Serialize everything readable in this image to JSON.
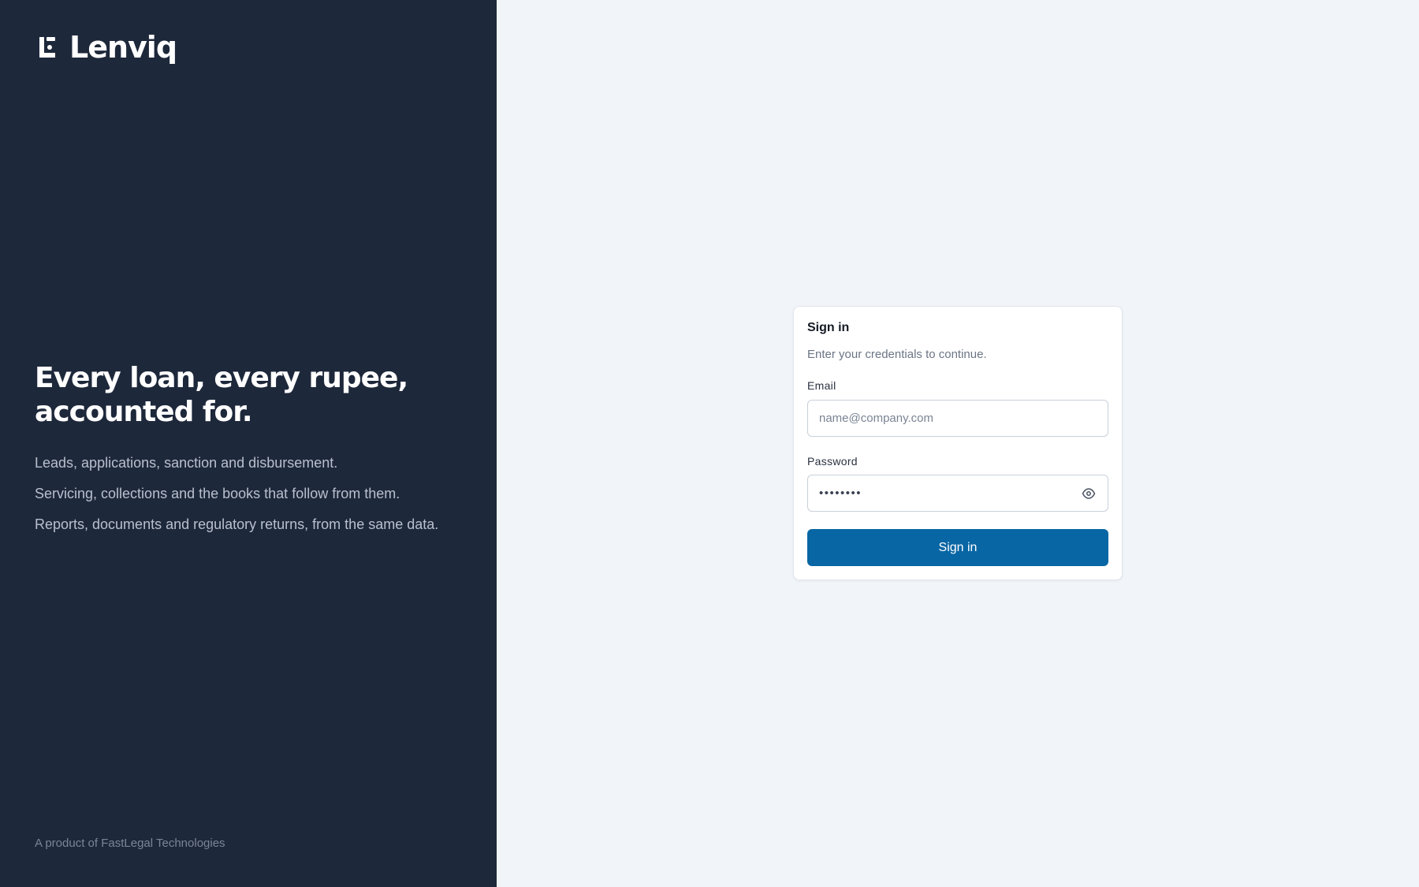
{
  "brand": {
    "name": "Lenviq",
    "headline_line1": "Every loan, every rupee,",
    "headline_line2": "accounted for.",
    "taglines": [
      "Leads, applications, sanction and disbursement.",
      "Servicing, collections and the books that follow from them.",
      "Reports, documents and regulatory returns, from the same data."
    ],
    "footer": "A product of FastLegal Technologies",
    "icon": "lenviq-logo-icon"
  },
  "signin": {
    "title": "Sign in",
    "subtitle": "Enter your credentials to continue.",
    "email": {
      "label": "Email",
      "placeholder": "name@company.com",
      "value": ""
    },
    "password": {
      "label": "Password",
      "masked_value": "••••••••",
      "toggle_icon": "eye-icon"
    },
    "submit_label": "Sign in"
  },
  "colors": {
    "left_panel_bg": "#1e283b",
    "right_panel_bg": "#f1f4f9",
    "primary_button": "#0866a4"
  }
}
